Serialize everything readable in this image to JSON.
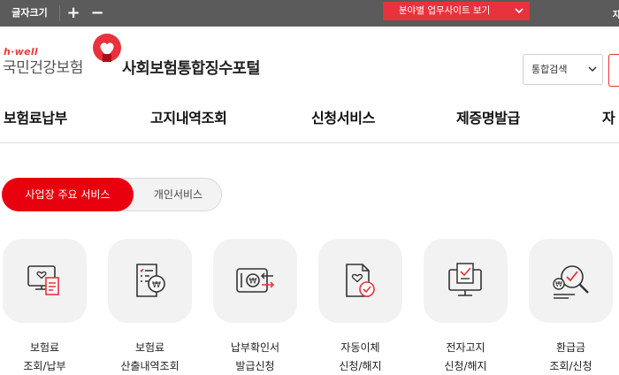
{
  "topbar": {
    "font_size_label": "글자크기",
    "plus": "+",
    "minus": "−",
    "site_dropdown": "분야별 업무사이트 보기",
    "edge_text": "자"
  },
  "header": {
    "logo_sub": "h·well",
    "logo_main": "국민건강보험",
    "portal_title": "사회보험통합징수포털",
    "search_select": "통합검색"
  },
  "nav": [
    "보험료납부",
    "고지내역조회",
    "신청서비스",
    "제증명발급",
    "자"
  ],
  "tabs": {
    "active": "사업장 주요 서비스",
    "inactive": "개인서비스"
  },
  "services": [
    {
      "line1": "보험료",
      "line2": "조회/납부",
      "icon": "monitor-receipt-icon"
    },
    {
      "line1": "보험료",
      "line2": "산출내역조회",
      "icon": "document-won-icon"
    },
    {
      "line1": "납부확인서",
      "line2": "발급신청",
      "icon": "card-won-icon"
    },
    {
      "line1": "자동이체",
      "line2": "신청/해지",
      "icon": "document-check-icon"
    },
    {
      "line1": "전자고지",
      "line2": "신청/해지",
      "icon": "monitor-check-icon"
    },
    {
      "line1": "환급금",
      "line2": "조회/신청",
      "icon": "magnifier-won-icon"
    }
  ],
  "colors": {
    "brand_red": "#e8000f",
    "topbar": "#5b5b5b",
    "card_bg": "#f2f2f2"
  }
}
